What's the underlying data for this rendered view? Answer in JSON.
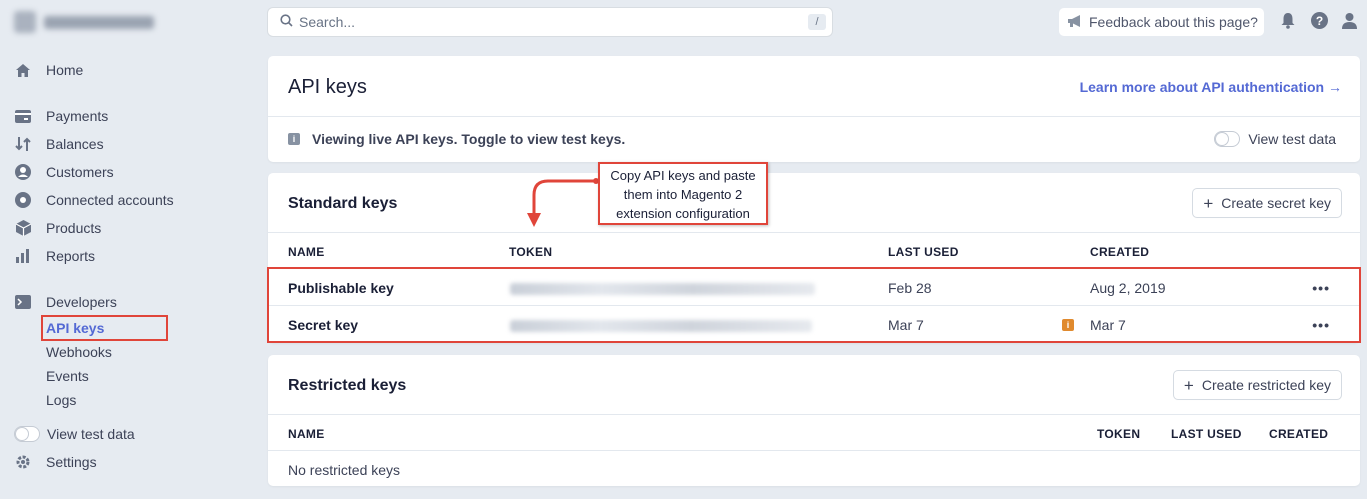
{
  "sidebar": {
    "home": "Home",
    "items": [
      "Payments",
      "Balances",
      "Customers",
      "Connected accounts",
      "Products",
      "Reports"
    ],
    "developers": "Developers",
    "dev_items": [
      "API keys",
      "Webhooks",
      "Events",
      "Logs"
    ],
    "view_test_data": "View test data",
    "settings": "Settings"
  },
  "topbar": {
    "search_placeholder": "Search...",
    "search_shortcut": "/",
    "feedback": "Feedback about this page?"
  },
  "api_card": {
    "title": "API keys",
    "learn_more": "Learn more about API authentication →",
    "info": "Viewing live API keys. Toggle to view test keys.",
    "view_test_data": "View test data"
  },
  "standard": {
    "title": "Standard keys",
    "create_button": "Create secret key",
    "headers": {
      "name": "NAME",
      "token": "TOKEN",
      "last_used": "LAST USED",
      "created": "CREATED"
    },
    "rows": [
      {
        "name": "Publishable key",
        "last_used": "Feb 28",
        "created": "Aug 2, 2019",
        "more": "•••"
      },
      {
        "name": "Secret key",
        "last_used": "Mar 7",
        "created": "Mar 7",
        "more": "•••"
      }
    ]
  },
  "restricted": {
    "title": "Restricted keys",
    "create_button": "Create restricted key",
    "headers": {
      "name": "NAME",
      "token": "TOKEN",
      "last_used": "LAST USED",
      "created": "CREATED"
    },
    "empty": "No restricted keys"
  },
  "annotation": {
    "callout": "Copy API keys and paste them into Magento 2 extension configuration"
  },
  "colors": {
    "accent": "#5469d4",
    "highlight": "#e0453a",
    "warning": "#e08a2e"
  }
}
